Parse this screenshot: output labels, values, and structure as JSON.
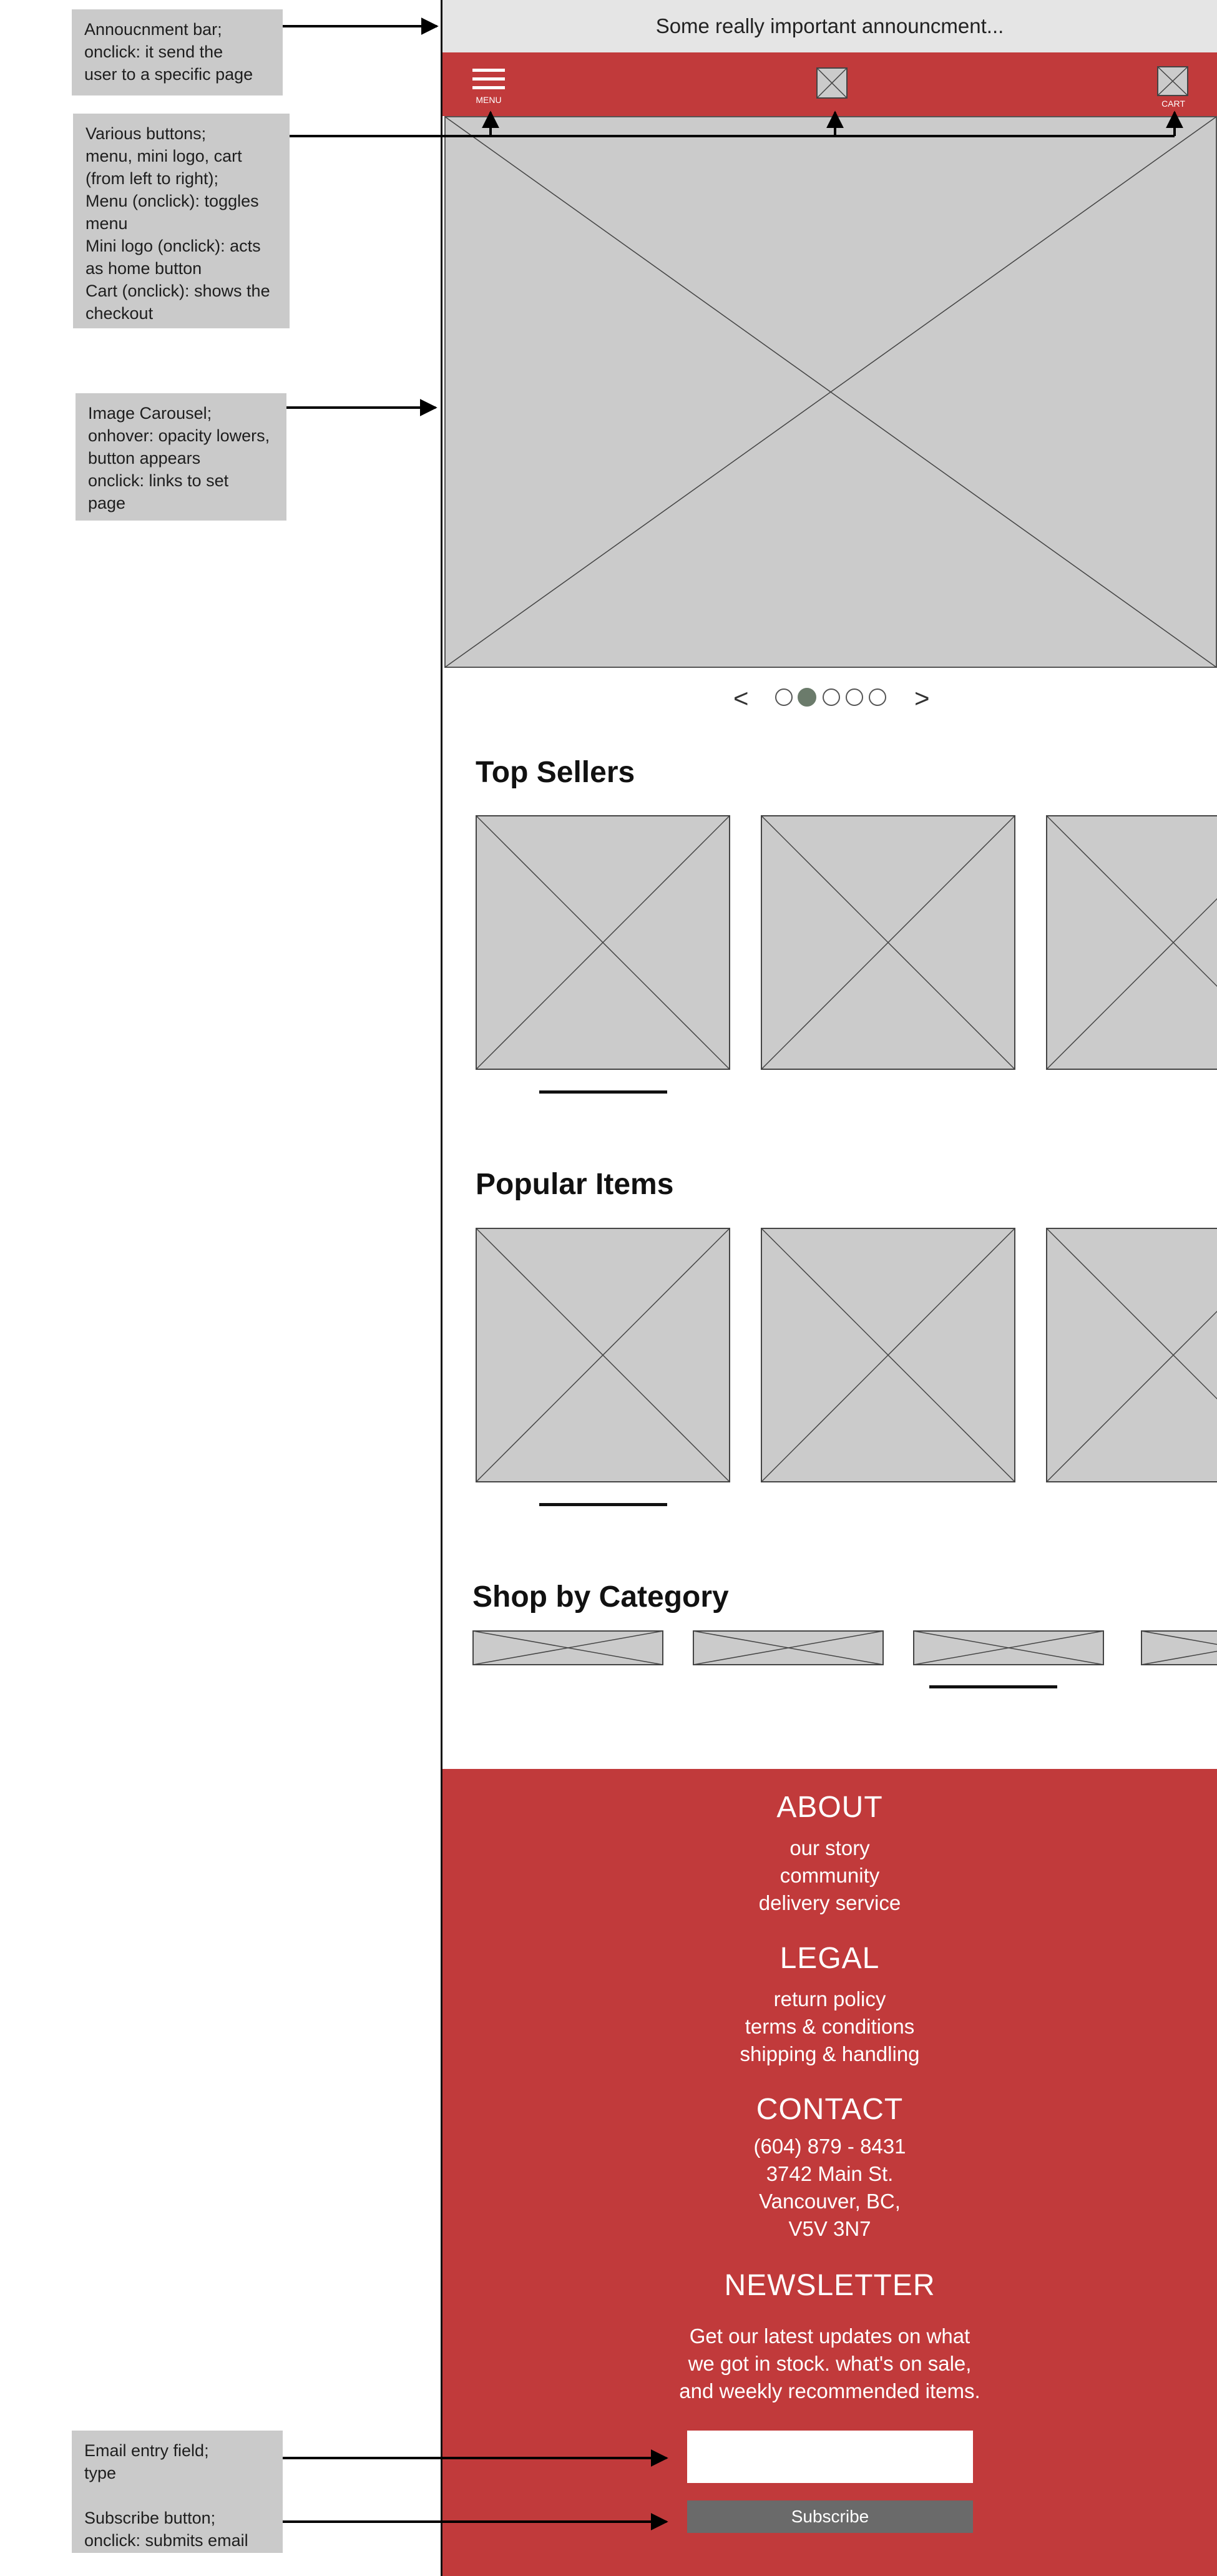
{
  "annotations": [
    {
      "lines": [
        "Annoucnment bar;",
        "onclick: it send the",
        "user to a specific page"
      ]
    },
    {
      "lines": [
        "Various buttons;",
        "menu, mini logo, cart",
        "(from left to right);",
        "Menu (onclick): toggles",
        "menu",
        "Mini logo (onclick): acts",
        "as home button",
        "Cart (onclick): shows the",
        "checkout"
      ]
    },
    {
      "lines": [
        "Image Carousel;",
        "onhover: opacity lowers,",
        "button appears",
        "onclick: links to set",
        "page"
      ]
    },
    {
      "lines": [
        "Email entry field;",
        "type",
        "",
        "Subscribe button;",
        "onclick: submits email"
      ]
    }
  ],
  "announcement": {
    "text": "Some really important announcment..."
  },
  "nav": {
    "menu_label": "MENU",
    "cart_label": "CART"
  },
  "carousel": {
    "prev": "<",
    "next": ">",
    "dot_count": 5,
    "active_index": 1
  },
  "sections": {
    "top_sellers": "Top Sellers",
    "popular_items": "Popular Items",
    "shop_by_category": "Shop by Category"
  },
  "footer": {
    "about": {
      "heading": "ABOUT",
      "links": [
        "our story",
        "community",
        "delivery service"
      ]
    },
    "legal": {
      "heading": "LEGAL",
      "links": [
        "return policy",
        "terms & conditions",
        "shipping & handling"
      ]
    },
    "contact": {
      "heading": "CONTACT",
      "lines": [
        "(604) 879 - 8431",
        "3742 Main St.",
        "Vancouver, BC,",
        "V5V 3N7"
      ]
    },
    "newsletter": {
      "heading": "NEWSLETTER",
      "lines": [
        "Get our latest updates on what",
        "we got in stock. what's on sale,",
        "and weekly recommended items."
      ],
      "email_placeholder": "",
      "subscribe_label": "Subscribe"
    }
  },
  "colors": {
    "brand_red": "#c13a3b",
    "placeholder_gray": "#cbcbcb",
    "note_gray": "#cacaca",
    "announcement_bg": "#e5e5e5",
    "subscribe_gray": "#6a6a6a",
    "carousel_dot_active": "#6b7b6b"
  }
}
